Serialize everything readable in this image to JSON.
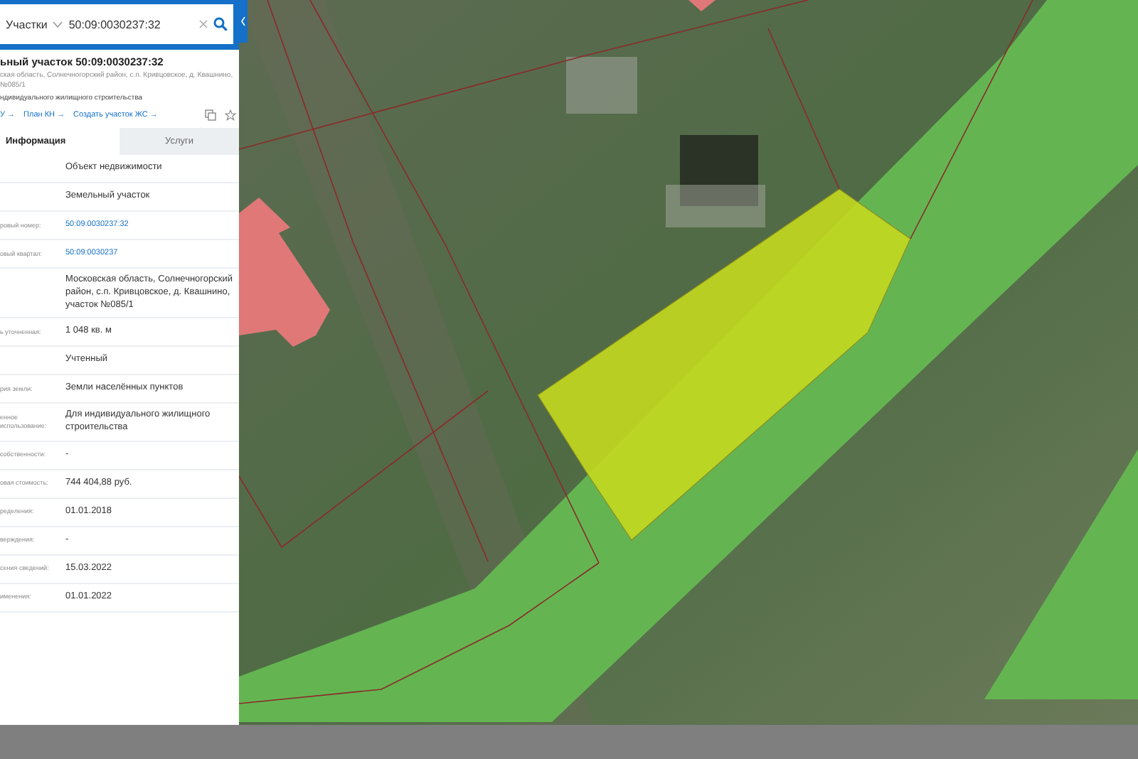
{
  "search": {
    "category": "Участки",
    "value": "50:09:0030237:32"
  },
  "object": {
    "title": "ьный участок 50:09:0030237:32",
    "address": "ская область, Солнечногорский район, с.п. Кривцовское, д. Квашнино, №085/1",
    "purpose": "ндивидуального жилищного строительства",
    "links": [
      {
        "label": "У →"
      },
      {
        "label": "План КН →"
      },
      {
        "label": "Создать участок ЖС →"
      }
    ]
  },
  "tabs": [
    {
      "label": "Информация",
      "selected": true
    },
    {
      "label": "Услуги",
      "selected": false
    }
  ],
  "rows": [
    {
      "value": "Объект недвижимости",
      "kind": "text"
    },
    {
      "value": "Земельный участок",
      "kind": "text"
    },
    {
      "label": "ровый номер:",
      "value": "50:09:0030237:32",
      "kind": "link"
    },
    {
      "label": "овый квартал:",
      "value": "50:09:0030237",
      "kind": "link"
    },
    {
      "value": "Московская область, Солнечногорский район, с.п. Кривцовское, д. Квашнино, участок №085/1",
      "kind": "text"
    },
    {
      "label": "ь уточненная:",
      "value": "1 048 кв. м",
      "kind": "text"
    },
    {
      "value": "Учтенный",
      "kind": "text"
    },
    {
      "label": "рия земли:",
      "value": "Земли населённых пунктов",
      "kind": "text"
    },
    {
      "label": "енное использование:",
      "value": "Для индивидуального жилищного строительства",
      "kind": "text"
    },
    {
      "label": "собственности:",
      "value": "-",
      "kind": "text"
    },
    {
      "label": "овая стоимость:",
      "value": "744 404,88 руб.",
      "kind": "text"
    },
    {
      "label": "ределения:",
      "value": "01.01.2018",
      "kind": "text"
    },
    {
      "label": "верждения:",
      "value": "-",
      "kind": "text"
    },
    {
      "label": "сения сведений:",
      "value": "15.03.2022",
      "kind": "text"
    },
    {
      "label": "именения:",
      "value": "01.01.2022",
      "kind": "text"
    }
  ]
}
